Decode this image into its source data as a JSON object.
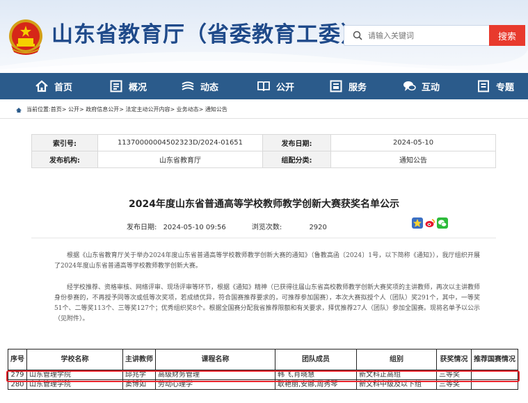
{
  "header": {
    "site_title": "山东省教育厅（省委教育工委）",
    "search_placeholder": "请输入关键词",
    "search_button": "搜索"
  },
  "nav": {
    "items": [
      {
        "label": "首页",
        "icon": "home-icon"
      },
      {
        "label": "概况",
        "icon": "overview-icon"
      },
      {
        "label": "动态",
        "icon": "news-icon"
      },
      {
        "label": "公开",
        "icon": "book-icon"
      },
      {
        "label": "服务",
        "icon": "service-icon"
      },
      {
        "label": "互动",
        "icon": "chat-icon"
      },
      {
        "label": "专题",
        "icon": "topic-icon"
      }
    ]
  },
  "breadcrumb": {
    "prefix": "当前位置:",
    "path": "首页> 公开> 政府信息公开> 法定主动公开内容> 业务动态> 通知公告"
  },
  "info_table": {
    "index_label": "索引号:",
    "index_value": "11370000004502323D/2024-01651",
    "date_label": "发布日期:",
    "date_value": "2024-05-10",
    "org_label": "发布机构:",
    "org_value": "山东省教育厅",
    "category_label": "组配分类:",
    "category_value": "通知公告"
  },
  "article": {
    "title": "2024年度山东省普通高等学校教师教学创新大赛获奖名单公示",
    "date_label": "发布日期:",
    "date_value": "2024-05-10 09:56",
    "views_label": "浏览次数:",
    "views_value": "2920",
    "para1": "根据《山东省教育厅关于举办2024年度山东省普通高等学校教师教学创新大赛的通知》（鲁教高函〔2024〕1号，以下简称《通知》），我厅组织开展了2024年度山东省普通高等学校教师教学创新大赛。",
    "para2": "经学校推荐、资格审核、网络评审、现场评审等环节，根据《通知》精神（已获得往届山东省高校教师教学创新大赛奖项的主讲教师，再次以主讲教师身份参赛的，不再授予同等次或低等次奖项，若成绩优异，符合国赛推荐要求的，可推荐参加国赛），本次大赛拟授个人（团队）奖291个，其中，一等奖51个、二等奖113个、三等奖127个；优秀组织奖8个。根据全国赛分配我省推荐限额和有关要求，择优推荐27人（团队）参加全国赛。现将名单予以公示（见附件）。"
  },
  "award_table": {
    "headers": {
      "seq": "序号",
      "school": "学校名称",
      "teacher": "主讲教师",
      "course": "课程名称",
      "team": "团队成员",
      "group": "组别",
      "award": "获奖情况",
      "recommend": "推荐国赛情况"
    },
    "rows": [
      {
        "seq": "279",
        "school": "山东管理学院",
        "teacher": "邱兆学",
        "course": "高级财务管理",
        "team": "韩飞,肖晓慧",
        "group": "新文科正高组",
        "award": "三等奖",
        "recommend": ""
      },
      {
        "seq": "280",
        "school": "山东管理学院",
        "teacher": "窦博如",
        "course": "劳动心理学",
        "team": "耿艳丽,安娜,周秀琴",
        "group": "新文科中级及以下组",
        "award": "三等奖",
        "recommend": ""
      }
    ]
  },
  "colors": {
    "nav_bg": "#2b5b8b",
    "title_blue": "#1f4a8a",
    "search_red": "#e83a2d",
    "highlight_red": "#e8232b"
  }
}
